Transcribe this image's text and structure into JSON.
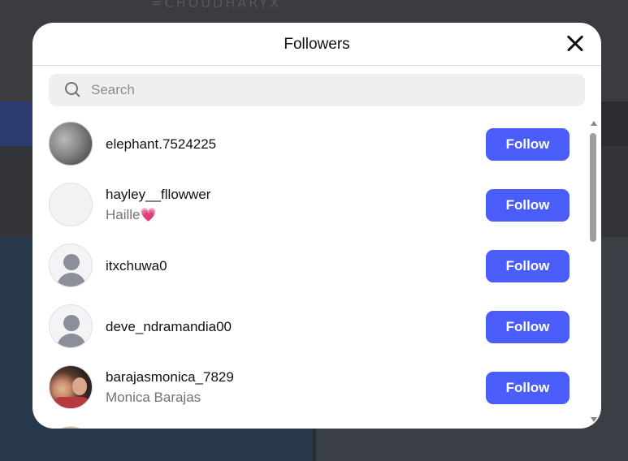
{
  "background": {
    "brand_text": "=CHOUDHARYX"
  },
  "modal": {
    "title": "Followers",
    "search_placeholder": "Search"
  },
  "followers": [
    {
      "username": "elephant.7524225",
      "fullname": "",
      "avatar": "moon",
      "button": "Follow"
    },
    {
      "username": "hayley__fllowwer",
      "fullname": "Haille",
      "emoji": "💗",
      "avatar": "blank",
      "button": "Follow"
    },
    {
      "username": "itxchuwa0",
      "fullname": "",
      "avatar": "default",
      "button": "Follow"
    },
    {
      "username": "deve_ndramandia00",
      "fullname": "",
      "avatar": "default",
      "button": "Follow"
    },
    {
      "username": "barajasmonica_7829",
      "fullname": "Monica Barajas",
      "avatar": "photo",
      "button": "Follow"
    }
  ],
  "colors": {
    "accent": "#4a5df9",
    "secondary_text": "#737373"
  }
}
